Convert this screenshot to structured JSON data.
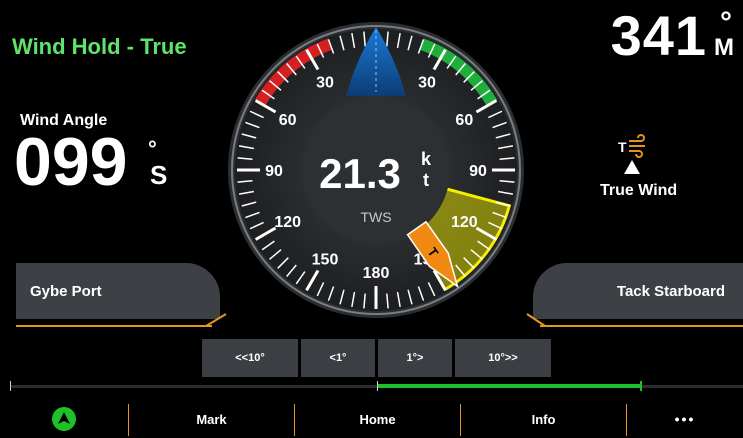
{
  "mode": {
    "title": "Wind Hold - True"
  },
  "heading": {
    "value": "341",
    "deg": "°",
    "ref": "M"
  },
  "wind_angle": {
    "label": "Wind Angle",
    "value": "099",
    "deg": "°",
    "side": "S"
  },
  "gauge": {
    "center_value": "21.3",
    "center_unit_top": "k",
    "center_unit_bottom": "t",
    "center_label": "TWS",
    "port_labels": [
      "30",
      "60",
      "90",
      "120",
      "150",
      "180"
    ],
    "stbd_labels": [
      "30",
      "60",
      "90",
      "120",
      "150"
    ],
    "colors": {
      "port": "#d42020",
      "starboard": "#1fae3b",
      "target": "#d7d400",
      "pointer": "#f08a12",
      "bow": "#1a7ad6"
    }
  },
  "true_wind": {
    "label": "True Wind",
    "icon": "true-wind-icon"
  },
  "actions": {
    "gybe": "Gybe Port",
    "tack": "Tack Starboard"
  },
  "steps": [
    "<<10°",
    "<1°",
    "1°>",
    "10°>>"
  ],
  "nav": {
    "home_icon": "navigation-arrow-icon",
    "mark": "Mark",
    "home": "Home",
    "info": "Info",
    "more": "•••"
  }
}
